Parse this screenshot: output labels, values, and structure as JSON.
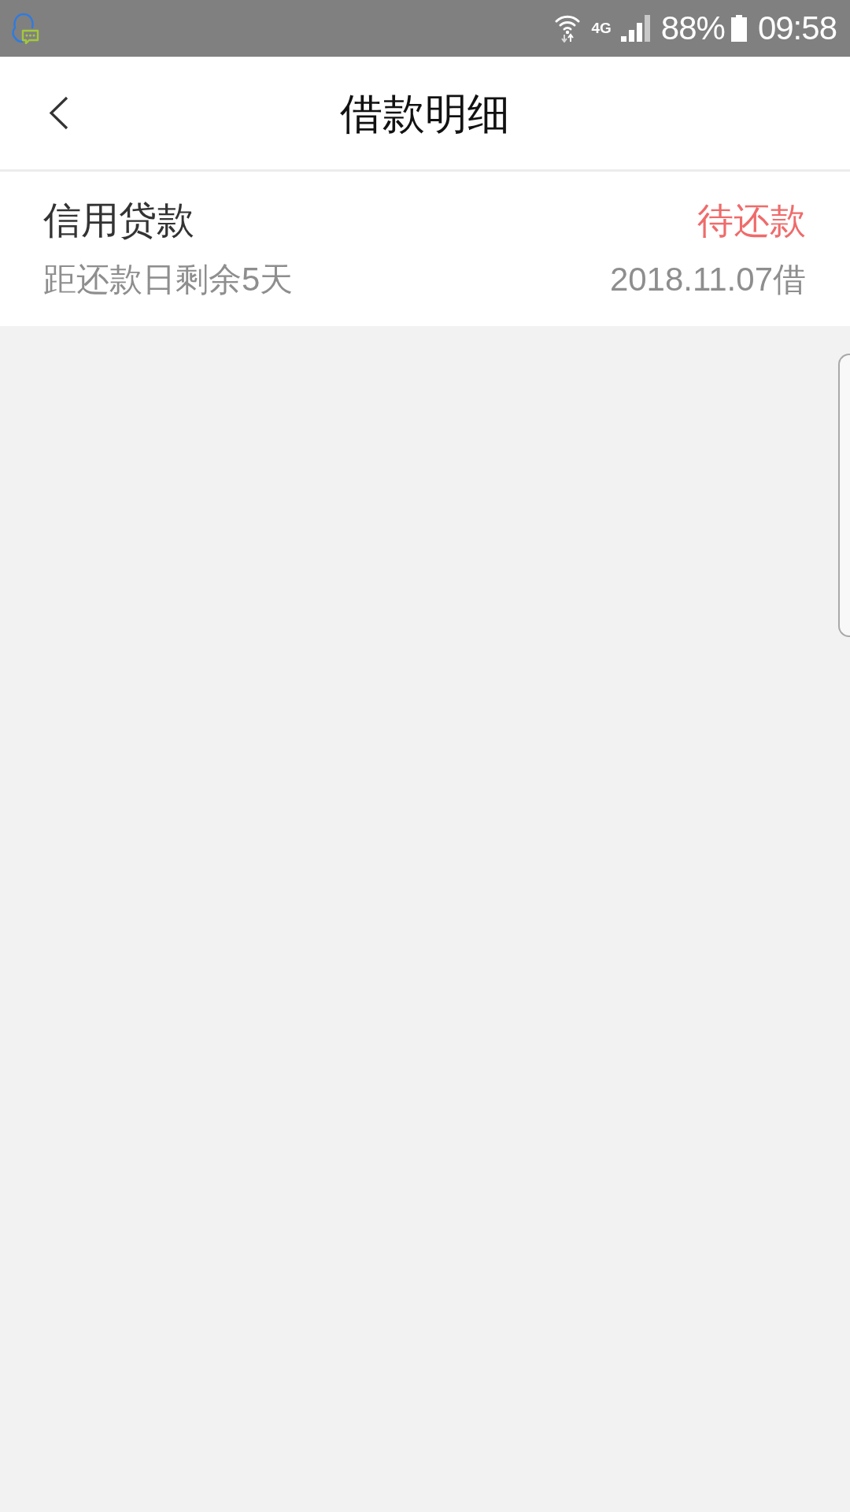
{
  "status_bar": {
    "network": "4G",
    "battery": "88%",
    "time": "09:58"
  },
  "header": {
    "title": "借款明细"
  },
  "loans": [
    {
      "name": "信用贷款",
      "status": "待还款",
      "due_note": "距还款日剩余5天",
      "borrowed_date": "2018.11.07借"
    }
  ]
}
